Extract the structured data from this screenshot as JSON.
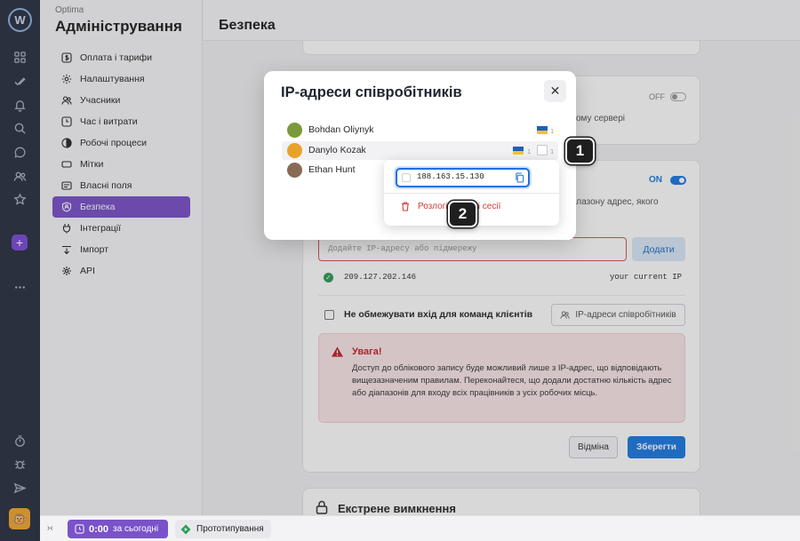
{
  "app": {
    "org": "Optima",
    "section_title": "Адміністрування",
    "page_title": "Безпека"
  },
  "rail": {
    "logo": "W",
    "icons": [
      "grid-icon",
      "check-icon",
      "bell-icon",
      "search-icon",
      "chat-icon",
      "users-icon",
      "star-icon",
      "plus-icon",
      "more-icon",
      "timer-icon",
      "bug-icon",
      "send-icon",
      "avatar"
    ]
  },
  "sidebar": {
    "items": [
      {
        "label": "Оплата і тарифи",
        "icon": "dollar-icon"
      },
      {
        "label": "Налаштування",
        "icon": "gear-icon"
      },
      {
        "label": "Учасники",
        "icon": "users-icon"
      },
      {
        "label": "Час і витрати",
        "icon": "clock-icon"
      },
      {
        "label": "Робочі процеси",
        "icon": "workflow-icon"
      },
      {
        "label": "Мітки",
        "icon": "tag-icon"
      },
      {
        "label": "Власні поля",
        "icon": "fields-icon"
      },
      {
        "label": "Безпека",
        "icon": "shield-icon",
        "active": true
      },
      {
        "label": "Інтеграції",
        "icon": "integrations-icon"
      },
      {
        "label": "Імпорт",
        "icon": "import-icon"
      },
      {
        "label": "API",
        "icon": "api-icon"
      }
    ]
  },
  "content": {
    "toggle_off_label": "OFF",
    "partial_text_1": "ому сервері",
    "toggle_on_label": "ON",
    "partial_text_2_line1": "іапазону адрес, якого",
    "partial_text_2_line2": "",
    "ip_input_placeholder": "Додайте IP-адресу або підмережу",
    "add_button": "Додати",
    "ip_entry": "209.127.202.146",
    "ip_entry_note": "your current IP",
    "no_limit_label": "Не обмежувати вхід для команд клієнтів",
    "employee_ips_button": "IP-адреси співробітників",
    "warning_title": "Увага!",
    "warning_text": "Доступ до облікового запису буде можливий лише з IP-адрес, що відповідають вищезазначеним правилам. Переконайтеся, що додали достатню кількість адрес або діапазонів для входу всіх працівників з усіх робочих місць.",
    "cancel_button": "Відміна",
    "save_button": "Зберегти",
    "emergency_title": "Екстрене вимкнення"
  },
  "modal": {
    "title": "IP-адреси співробітників",
    "close_glyph": "✕",
    "employees": [
      {
        "name": "Bohdan Oliynyk",
        "avatar_color": "#7a9a3a",
        "flag_count": "1"
      },
      {
        "name": "Danylo Kozak",
        "avatar_color": "#e8a22a",
        "flag_count": "1",
        "session_count": "1"
      },
      {
        "name": "Ethan Hunt",
        "avatar_color": "#8a6a55"
      }
    ]
  },
  "dropdown": {
    "ip_value": "188.163.15.130",
    "action_label": "Розлогінити всі сесії"
  },
  "callouts": [
    "1",
    "2"
  ],
  "statusbar": {
    "collapse_glyph": "›‹",
    "timer_value": "0:00",
    "timer_suffix": "за сьогодні",
    "project_label": "Прототипування"
  },
  "colors": {
    "accent": "#7a52c9",
    "primary": "#1e7be3",
    "danger": "#d33a3a"
  }
}
